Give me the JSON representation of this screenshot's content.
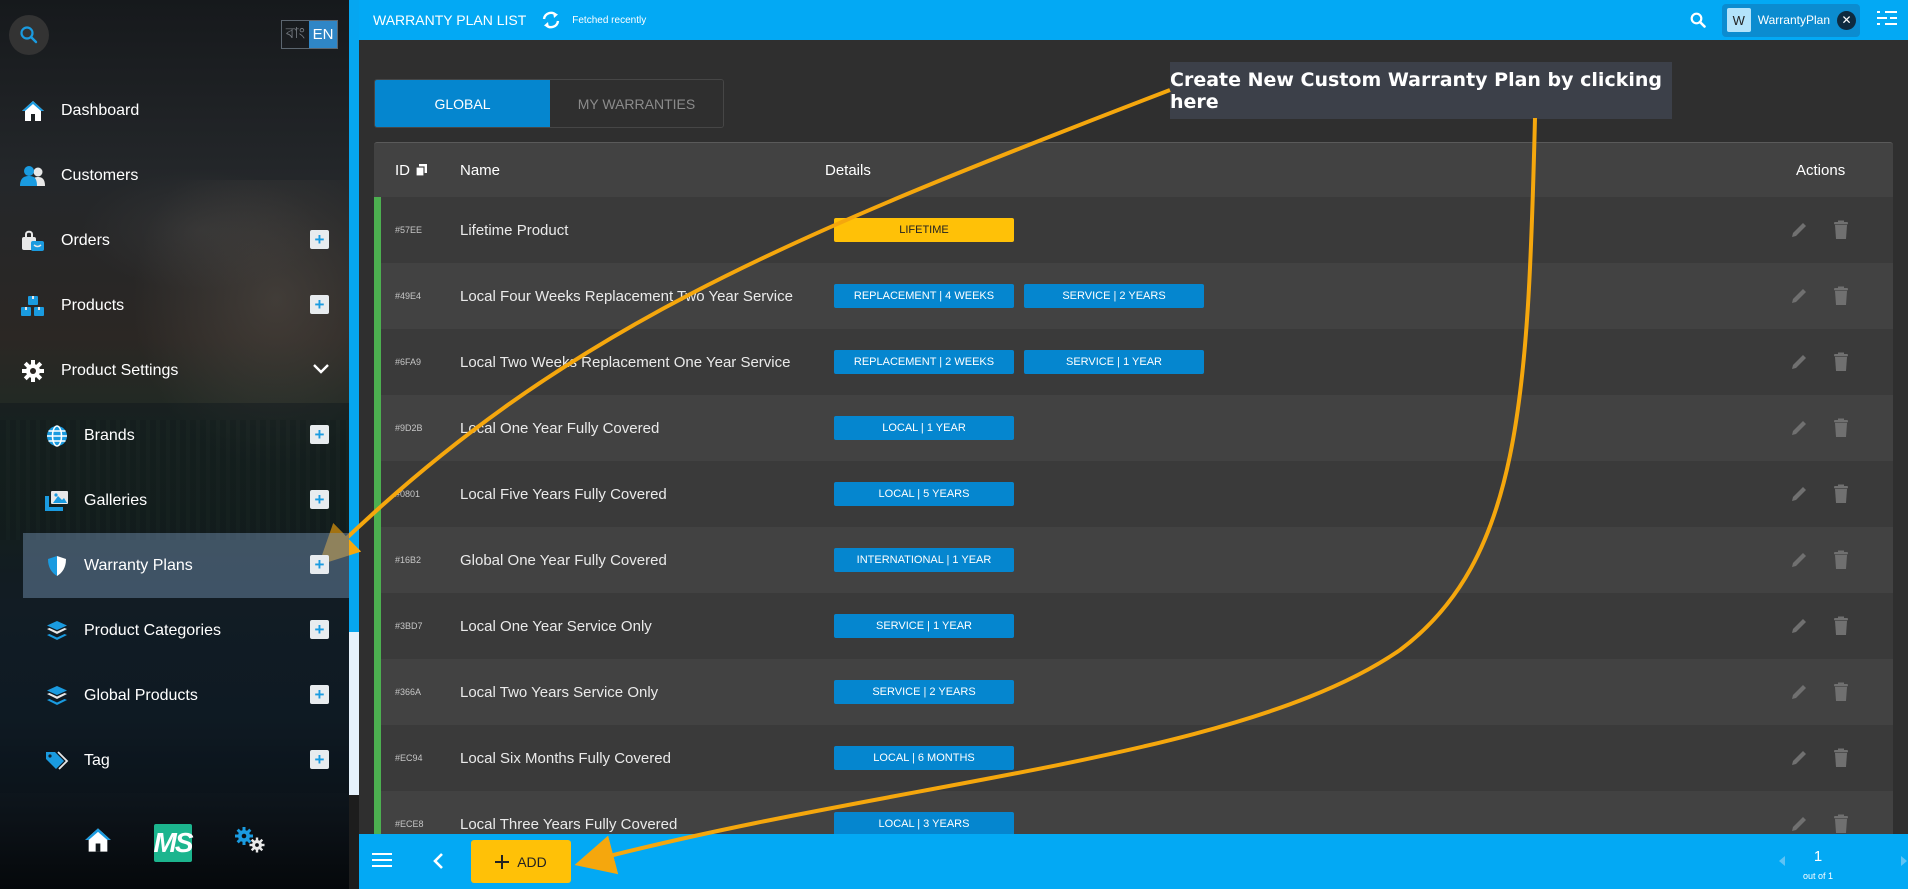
{
  "sidebar": {
    "lang": {
      "bn": "বাং",
      "en": "EN"
    },
    "items": [
      {
        "label": "Dashboard",
        "icon": "home-icon",
        "plus": false
      },
      {
        "label": "Customers",
        "icon": "customers-icon",
        "plus": false
      },
      {
        "label": "Orders",
        "icon": "orders-icon",
        "plus": true
      },
      {
        "label": "Products",
        "icon": "products-icon",
        "plus": true
      },
      {
        "label": "Product Settings",
        "icon": "gear-icon",
        "expanded": true
      }
    ],
    "subitems": [
      {
        "label": "Brands",
        "icon": "globe-icon"
      },
      {
        "label": "Galleries",
        "icon": "gallery-icon"
      },
      {
        "label": "Warranty Plans",
        "icon": "shield-icon",
        "active": true
      },
      {
        "label": "Product Categories",
        "icon": "layers-icon"
      },
      {
        "label": "Global Products",
        "icon": "layers-icon"
      },
      {
        "label": "Tag",
        "icon": "tag-icon"
      }
    ],
    "bottom": {
      "logo_text": "MS"
    }
  },
  "header": {
    "title": "WARRANTY PLAN LIST",
    "status": "Fetched recently",
    "chip": {
      "initial": "W",
      "label": "WarrantyPlan"
    }
  },
  "tabs": [
    {
      "label": "GLOBAL",
      "active": true
    },
    {
      "label": "MY WARRANTIES",
      "active": false
    }
  ],
  "table": {
    "columns": {
      "id": "ID",
      "name": "Name",
      "details": "Details",
      "actions": "Actions"
    },
    "rows": [
      {
        "id": "#57EE",
        "name": "Lifetime Product",
        "badges": [
          {
            "text": "LIFETIME",
            "style": "gold"
          }
        ]
      },
      {
        "id": "#49E4",
        "name": "Local Four Weeks Replacement Two Year Service",
        "badges": [
          {
            "text": "REPLACEMENT | 4 WEEKS"
          },
          {
            "text": "SERVICE | 2 YEARS"
          }
        ]
      },
      {
        "id": "#6FA9",
        "name": "Local Two Weeks Replacement One Year Service",
        "badges": [
          {
            "text": "REPLACEMENT | 2 WEEKS"
          },
          {
            "text": "SERVICE | 1 YEAR"
          }
        ]
      },
      {
        "id": "#9D2B",
        "name": "Local One Year Fully Covered",
        "badges": [
          {
            "text": "LOCAL | 1 YEAR"
          }
        ]
      },
      {
        "id": "#0801",
        "name": "Local Five Years Fully Covered",
        "badges": [
          {
            "text": "LOCAL | 5 YEARS"
          }
        ]
      },
      {
        "id": "#16B2",
        "name": "Global One Year Fully Covered",
        "badges": [
          {
            "text": "INTERNATIONAL | 1 YEAR"
          }
        ]
      },
      {
        "id": "#3BD7",
        "name": "Local One Year Service Only",
        "badges": [
          {
            "text": "SERVICE | 1 YEAR"
          }
        ]
      },
      {
        "id": "#366A",
        "name": "Local Two Years Service Only",
        "badges": [
          {
            "text": "SERVICE | 2 YEARS"
          }
        ]
      },
      {
        "id": "#EC94",
        "name": "Local Six Months Fully Covered",
        "badges": [
          {
            "text": "LOCAL | 6 MONTHS"
          }
        ]
      },
      {
        "id": "#ECE8",
        "name": "Local Three Years Fully Covered",
        "badges": [
          {
            "text": "LOCAL | 3 YEARS"
          }
        ]
      }
    ]
  },
  "footer": {
    "add_label": "ADD",
    "page": "1",
    "page_of": "out of 1"
  },
  "callout": {
    "text": "Create New Custom Warranty Plan by clicking here"
  },
  "colors": {
    "accent": "#03a9f4",
    "tab_active": "#0586cf",
    "badge": "#0586cf",
    "badge_gold": "#ffc107",
    "row_marker": "#4caf50",
    "arrow": "#f5a70d"
  }
}
